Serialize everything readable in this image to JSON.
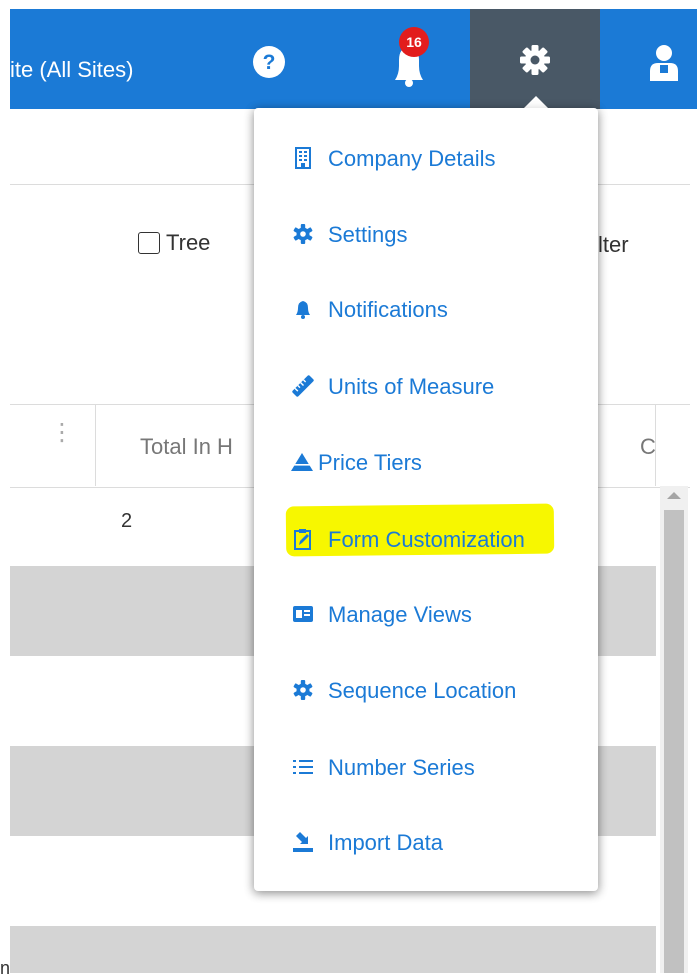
{
  "header": {
    "site_selector": "ite (All Sites)",
    "notification_count": "16"
  },
  "page": {
    "tree_label": "Tree",
    "filter_fragment": "lter",
    "column_total_header": "Total In H",
    "column_c_header": "C",
    "first_row_value": "2",
    "left_fragment": "n"
  },
  "settings_menu": {
    "items": [
      {
        "label": "Company Details",
        "icon": "building-icon"
      },
      {
        "label": "Settings",
        "icon": "gear-icon"
      },
      {
        "label": "Notifications",
        "icon": "bell-icon"
      },
      {
        "label": "Units of Measure",
        "icon": "ruler-icon"
      },
      {
        "label": "Price Tiers",
        "icon": "pyramid-icon"
      },
      {
        "label": "Form Customization",
        "icon": "form-edit-icon",
        "highlighted": true
      },
      {
        "label": "Manage Views",
        "icon": "views-icon"
      },
      {
        "label": "Sequence Location",
        "icon": "gear-icon"
      },
      {
        "label": "Number Series",
        "icon": "list-icon"
      },
      {
        "label": "Import Data",
        "icon": "import-icon"
      }
    ]
  },
  "colors": {
    "header_blue": "#1b7ad6",
    "active_tab": "#495866",
    "badge_red": "#e21d1d",
    "highlight_yellow": "#f7f700",
    "row_stripe": "#d4d4d4"
  }
}
